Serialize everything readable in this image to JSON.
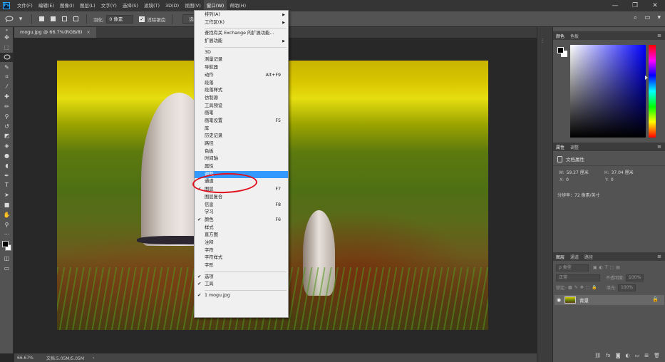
{
  "menubar": {
    "logo": "Ps",
    "items": [
      "文件(F)",
      "编辑(E)",
      "图像(I)",
      "图层(L)",
      "文字(Y)",
      "选择(S)",
      "滤镜(T)",
      "3D(D)",
      "视图(V)",
      "窗口(W)",
      "帮助(H)"
    ],
    "active_index": 9,
    "window_controls": [
      "—",
      "❐",
      "✕"
    ]
  },
  "options": {
    "feather_label": "羽化:",
    "feather_value": "0 像素",
    "antialias_label": "消除锯齿",
    "antialias_checked": true,
    "select_mask_button": "选择并遮住..."
  },
  "document": {
    "tab_title": "mogu.jpg @ 66.7%(RGB/8)",
    "tab_close": "×"
  },
  "statusbar": {
    "zoom": "66.67%",
    "doc_size": "文档:5.05M/5.05M"
  },
  "window_menu": {
    "items": [
      {
        "label": "排列(A)",
        "submenu": true
      },
      {
        "label": "工作区(K)",
        "submenu": true
      },
      {
        "separator": true
      },
      {
        "label": "查找有关 Exchange 的扩展功能..."
      },
      {
        "label": "扩展功能",
        "submenu": true
      },
      {
        "separator": true
      },
      {
        "label": "3D"
      },
      {
        "label": "测量记录"
      },
      {
        "label": "导航器"
      },
      {
        "label": "动作",
        "shortcut": "Alt+F9"
      },
      {
        "label": "段落"
      },
      {
        "label": "段落样式"
      },
      {
        "label": "仿制源"
      },
      {
        "label": "工具预设"
      },
      {
        "label": "画笔"
      },
      {
        "label": "画笔设置",
        "shortcut": "F5"
      },
      {
        "label": "库"
      },
      {
        "label": "历史记录"
      },
      {
        "label": "路径"
      },
      {
        "label": "色板"
      },
      {
        "label": "时间轴"
      },
      {
        "label": "属性"
      },
      {
        "label": "调整",
        "highlighted": true
      },
      {
        "label": "通道"
      },
      {
        "label": "图层",
        "checked": true,
        "shortcut": "F7"
      },
      {
        "label": "图层复合"
      },
      {
        "label": "信息",
        "shortcut": "F8"
      },
      {
        "label": "学习"
      },
      {
        "label": "颜色",
        "checked": true,
        "shortcut": "F6"
      },
      {
        "label": "样式"
      },
      {
        "label": "直方图"
      },
      {
        "label": "注释"
      },
      {
        "label": "字符"
      },
      {
        "label": "字符样式"
      },
      {
        "label": "字形"
      },
      {
        "separator": true
      },
      {
        "label": "选项",
        "checked": true
      },
      {
        "label": "工具",
        "checked": true
      },
      {
        "separator": true
      },
      {
        "label": "1 mogu.jpg",
        "checked": true
      }
    ]
  },
  "color_panel": {
    "tabs": [
      "颜色",
      "色板"
    ]
  },
  "properties_panel": {
    "tabs": [
      "属性",
      "调整"
    ],
    "doc_props_label": "文档属性",
    "w_label": "W:",
    "w_value": "59.27 厘米",
    "h_label": "H:",
    "h_value": "37.04 厘米",
    "x_label": "X:",
    "x_value": "0",
    "y_label": "Y:",
    "y_value": "0",
    "resolution": "分辨率：72 像素/英寸"
  },
  "layers_panel": {
    "tabs": [
      "图层",
      "通道",
      "路径"
    ],
    "kind_filter": "ρ 类型",
    "blend_mode": "正常",
    "opacity_label": "不透明度:",
    "opacity_value": "100%",
    "lock_label": "锁定:",
    "fill_label": "填充:",
    "fill_value": "100%",
    "layer_name": "背景"
  },
  "colors": {
    "menu_highlight": "#3399ff",
    "annotation": "#e0101e",
    "ui_dark": "#535353"
  }
}
